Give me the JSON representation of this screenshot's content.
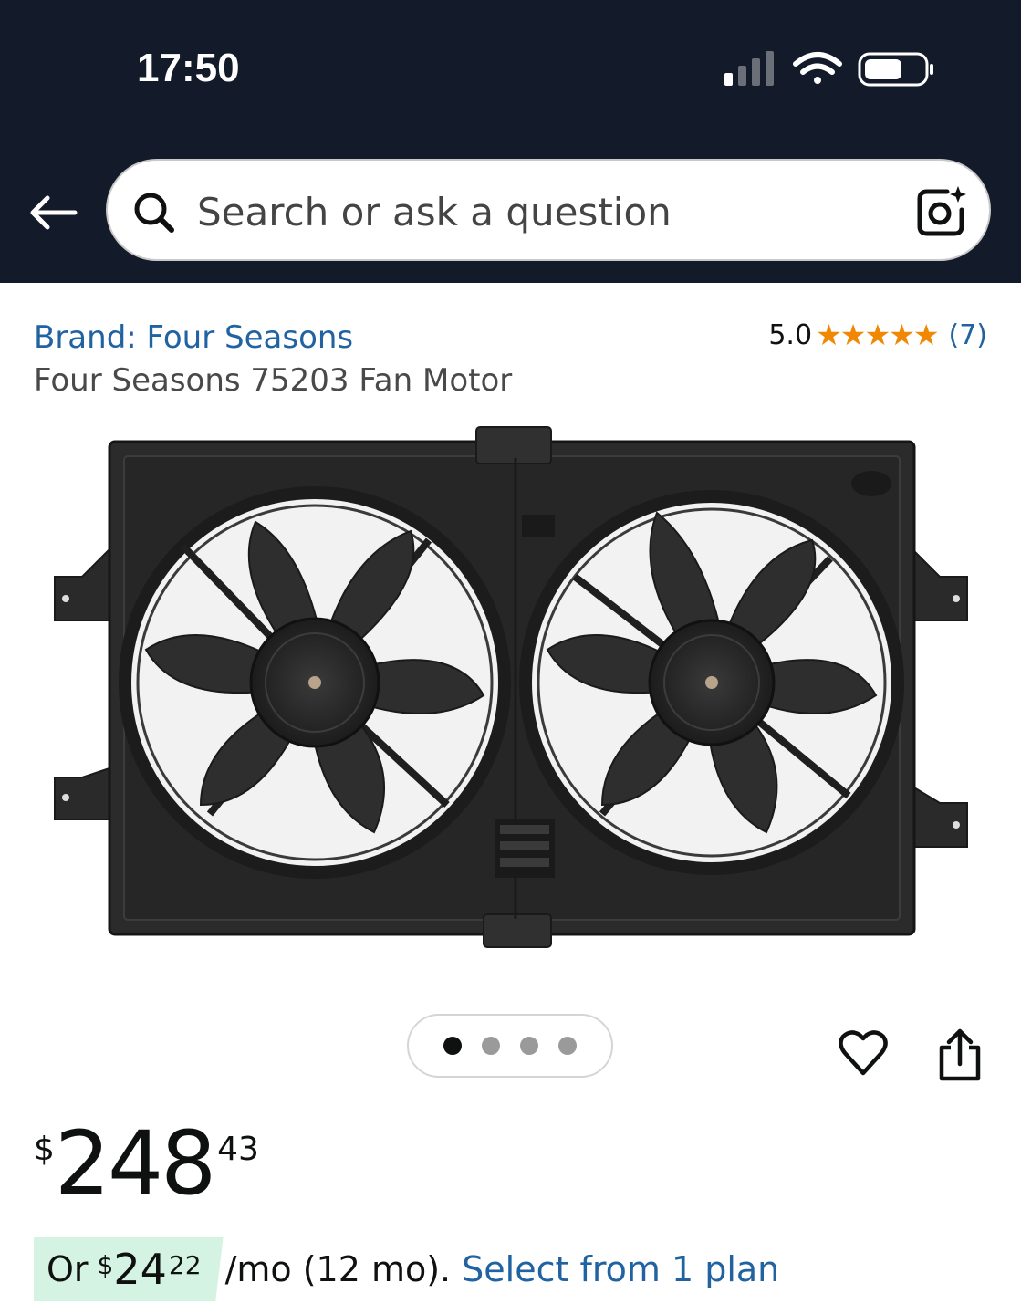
{
  "status_bar": {
    "time": "17:50"
  },
  "search": {
    "placeholder": "Search or ask a question"
  },
  "product": {
    "brand_link": "Brand: Four Seasons",
    "title": "Four Seasons 75203 Fan Motor",
    "rating_value": "5.0",
    "stars": "★★★★★",
    "rating_count": "(7)",
    "image_count": 4,
    "active_image": 0
  },
  "price": {
    "symbol": "$",
    "whole": "248",
    "fraction": "43"
  },
  "installment": {
    "prefix": "Or",
    "symbol": "$",
    "whole": "24",
    "fraction": "22",
    "suffix": "/mo (12 mo).",
    "link": "Select from 1 plan"
  },
  "colors": {
    "header_bg": "#131a29",
    "link": "#2162a1",
    "star": "#f08804",
    "installment_bg": "#d5f3e2"
  }
}
